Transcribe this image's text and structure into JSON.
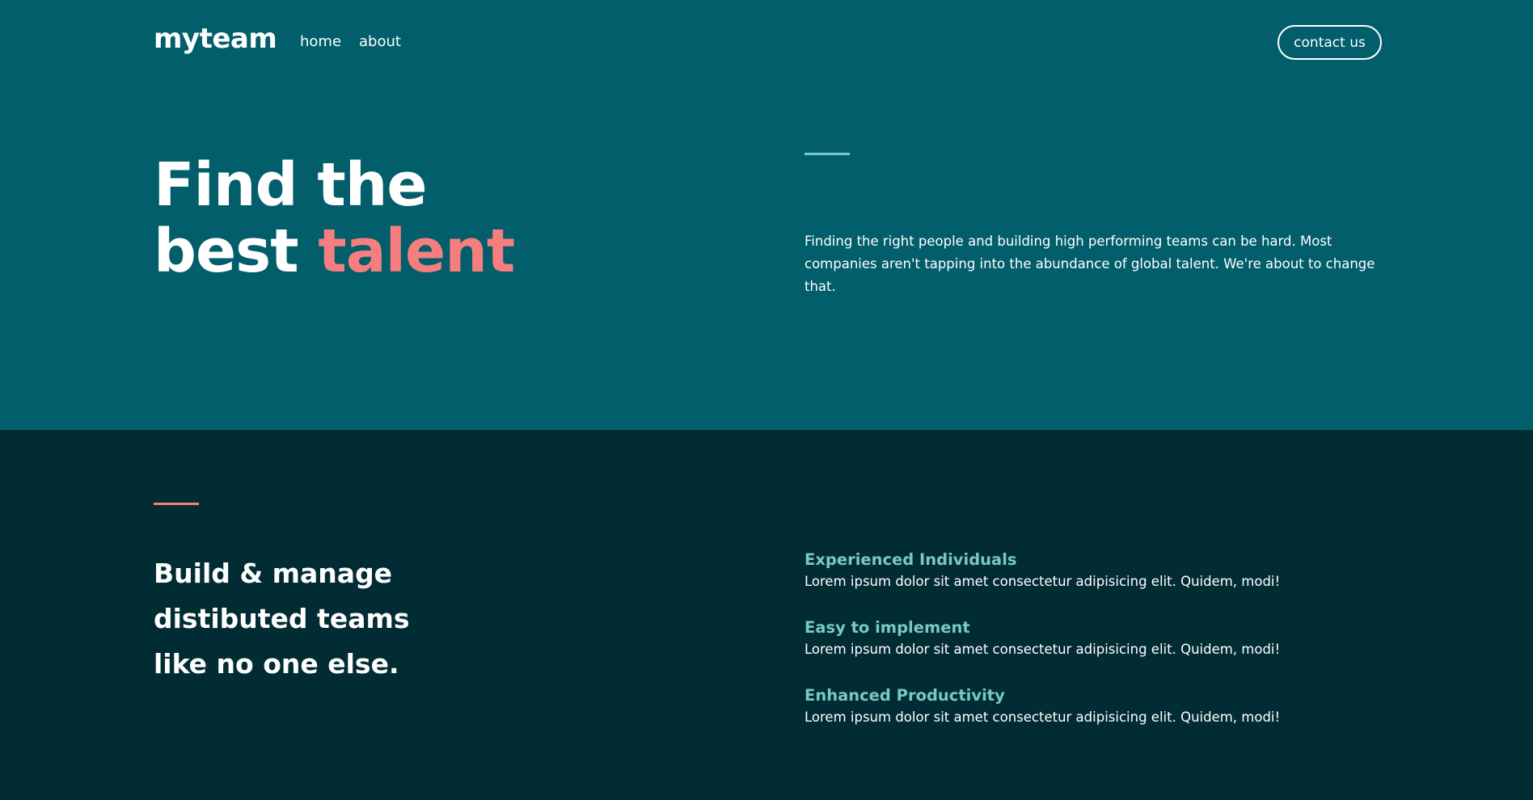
{
  "brand": {
    "logo": "myteam"
  },
  "nav": {
    "items": [
      {
        "label": "home"
      },
      {
        "label": "about"
      }
    ],
    "contact_label": "contact us"
  },
  "hero": {
    "title_line1": "Find the",
    "title_line2_plain": "best ",
    "title_line2_accent": "talent",
    "description": "Finding the right people and building high performing teams can be hard. Most companies aren't tapping into the abundance of global talent. We're about to change that."
  },
  "features": {
    "title_line1": "Build & manage",
    "title_line2": "distibuted teams",
    "title_line3": "like no one else.",
    "items": [
      {
        "heading": "Experienced Individuals",
        "text": "Lorem ipsum dolor sit amet consectetur adipisicing elit. Quidem, modi!"
      },
      {
        "heading": "Easy to implement",
        "text": "Lorem ipsum dolor sit amet consectetur adipisicing elit. Quidem, modi!"
      },
      {
        "heading": "Enhanced Productivity",
        "text": "Lorem ipsum dolor sit amet consectetur adipisicing elit. Quidem, modi!"
      }
    ]
  },
  "colors": {
    "hero_bg": "#025E6B",
    "dark_bg": "#022C34",
    "accent_coral": "#F67E7E",
    "accent_teal": "#79C8C7",
    "text": "#FFFFFF"
  }
}
